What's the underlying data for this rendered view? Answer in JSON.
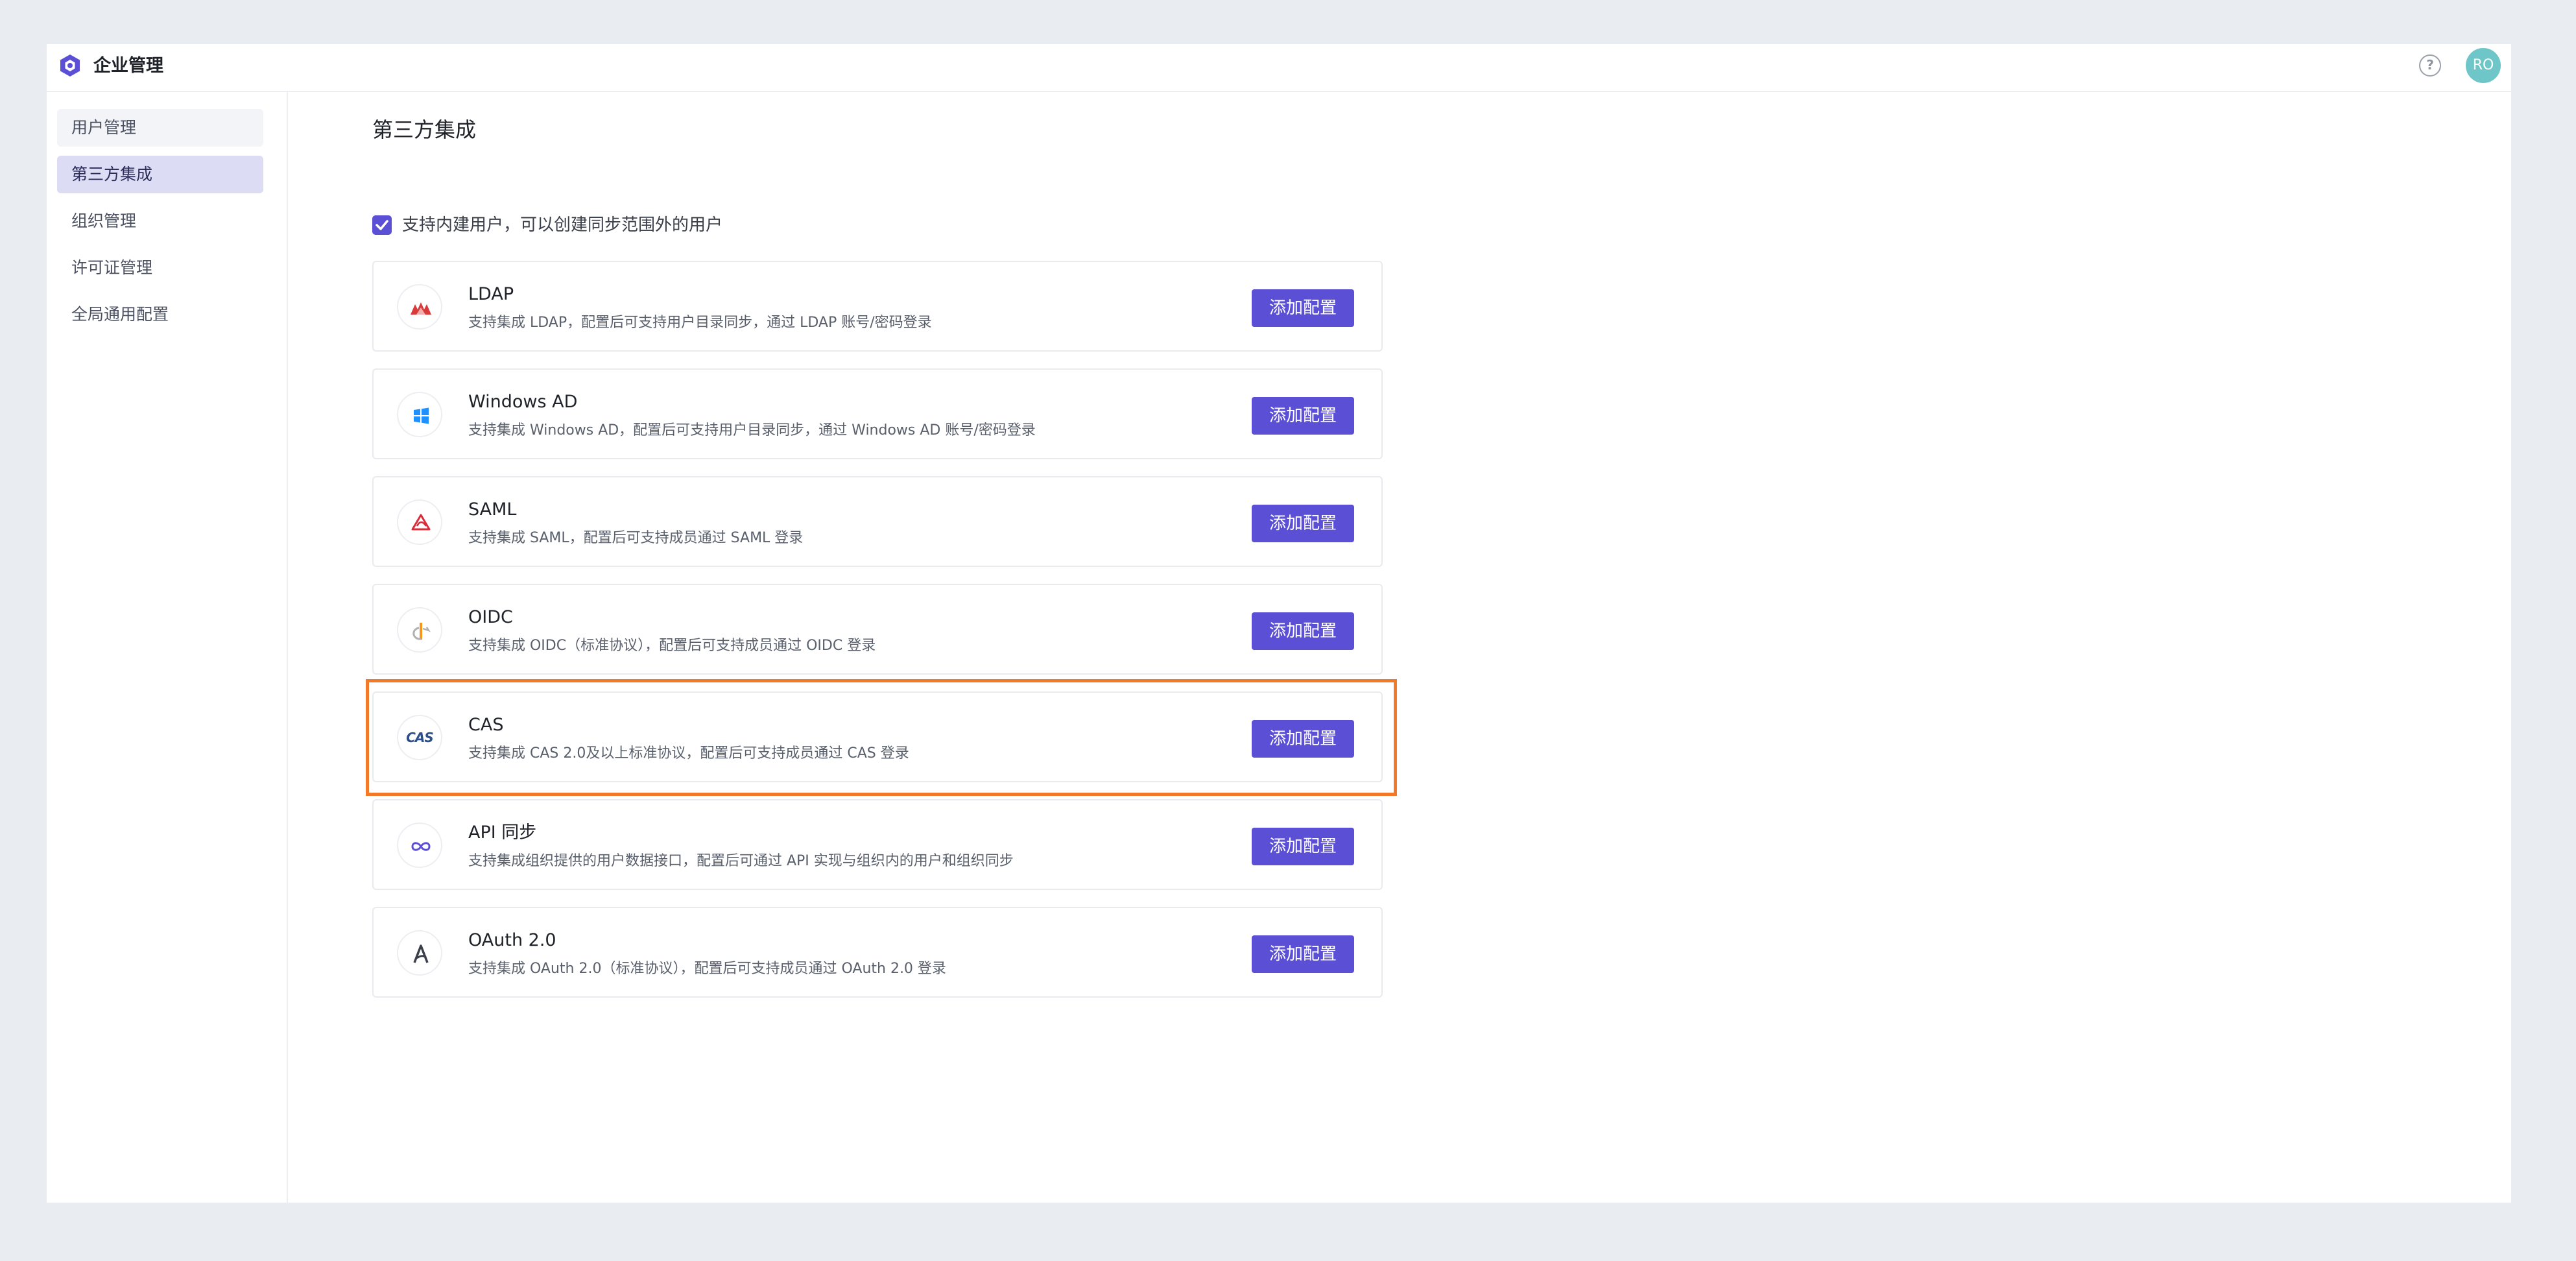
{
  "header": {
    "app_title": "企业管理",
    "help_symbol": "?",
    "avatar_initials": "RO",
    "logo_icon": "hexagon-logo-icon",
    "help_icon": "question-circle-icon"
  },
  "sidebar": {
    "items": [
      {
        "label": "用户管理"
      },
      {
        "label": "第三方集成",
        "active": true
      },
      {
        "label": "组织管理"
      },
      {
        "label": "许可证管理"
      },
      {
        "label": "全局通用配置"
      }
    ]
  },
  "main": {
    "title": "第三方集成",
    "checkbox": {
      "checked": true,
      "label": "支持内建用户，可以创建同步范围外的用户"
    },
    "integrations": [
      {
        "title": "LDAP",
        "desc": "支持集成 LDAP，配置后可支持用户目录同步，通过 LDAP 账号/密码登录",
        "button": "添加配置",
        "icon": "ldap-icon"
      },
      {
        "title": "Windows AD",
        "desc": "支持集成 Windows AD，配置后可支持用户目录同步，通过 Windows AD 账号/密码登录",
        "button": "添加配置",
        "icon": "windows-icon"
      },
      {
        "title": "SAML",
        "desc": "支持集成 SAML，配置后可支持成员通过 SAML 登录",
        "button": "添加配置",
        "icon": "saml-icon"
      },
      {
        "title": "OIDC",
        "desc": "支持集成 OIDC（标准协议），配置后可支持成员通过 OIDC 登录",
        "button": "添加配置",
        "icon": "openid-icon"
      },
      {
        "title": "CAS",
        "desc": "支持集成 CAS 2.0及以上标准协议，配置后可支持成员通过 CAS 登录",
        "button": "添加配置",
        "icon": "cas-icon",
        "icon_text": "CAS"
      },
      {
        "title": "API 同步",
        "desc": "支持集成组织提供的用户数据接口，配置后可通过 API 实现与组织内的用户和组织同步",
        "button": "添加配置",
        "icon": "infinity-icon"
      },
      {
        "title": "OAuth 2.0",
        "desc": "支持集成 OAuth 2.0（标准协议），配置后可支持成员通过 OAuth 2.0 登录",
        "button": "添加配置",
        "icon": "oauth-icon"
      }
    ]
  },
  "colors": {
    "accent": "#5b4fd6",
    "highlight": "#f07a2a",
    "avatar": "#6ec6c9",
    "background": "#e9ecf0"
  }
}
